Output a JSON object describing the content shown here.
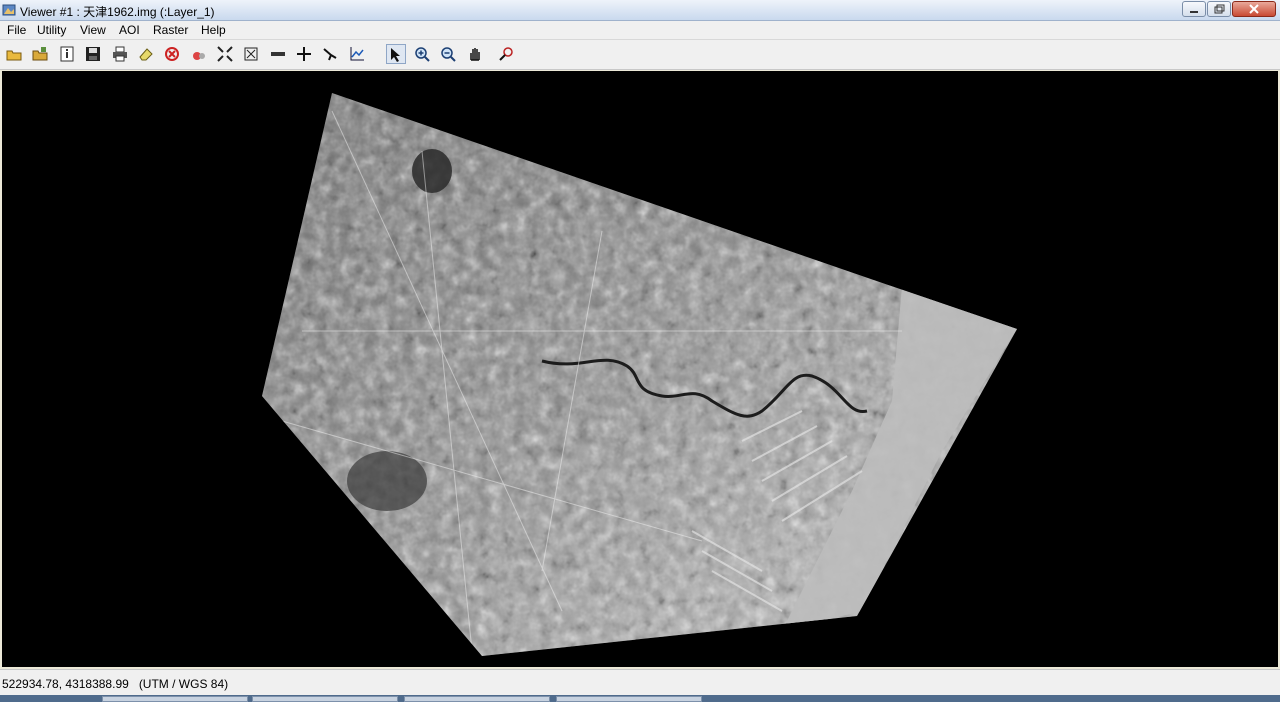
{
  "window": {
    "title": "Viewer #1 : 天津1962.img (:Layer_1)",
    "icon": "viewer-app-icon"
  },
  "menu": [
    "File",
    "Utility",
    "View",
    "AOI",
    "Raster",
    "Help"
  ],
  "toolbar": {
    "tools": [
      "open-icon",
      "open-layer-icon",
      "info-icon",
      "save-icon",
      "print-icon",
      "eraser-icon",
      "close-layer-icon",
      "clear-icon",
      "fit-icon",
      "extent-icon",
      "measure-icon",
      "crosshair-icon",
      "inquire-icon",
      "profile-icon",
      "select-icon",
      "zoom-in-icon",
      "zoom-out-icon",
      "pan-icon",
      "link-icon"
    ],
    "active_tool": "select-icon"
  },
  "viewer": {
    "image": "天津1962.img",
    "layer": "Layer_1",
    "colors": {
      "background": "#000000",
      "raster_light": "#d8d8d8",
      "raster_dark": "#3a3a3a",
      "water": "#b9b9b9"
    }
  },
  "status": {
    "coordinates": "522934.78, 4318388.99",
    "projection": "(UTM / WGS 84)"
  }
}
